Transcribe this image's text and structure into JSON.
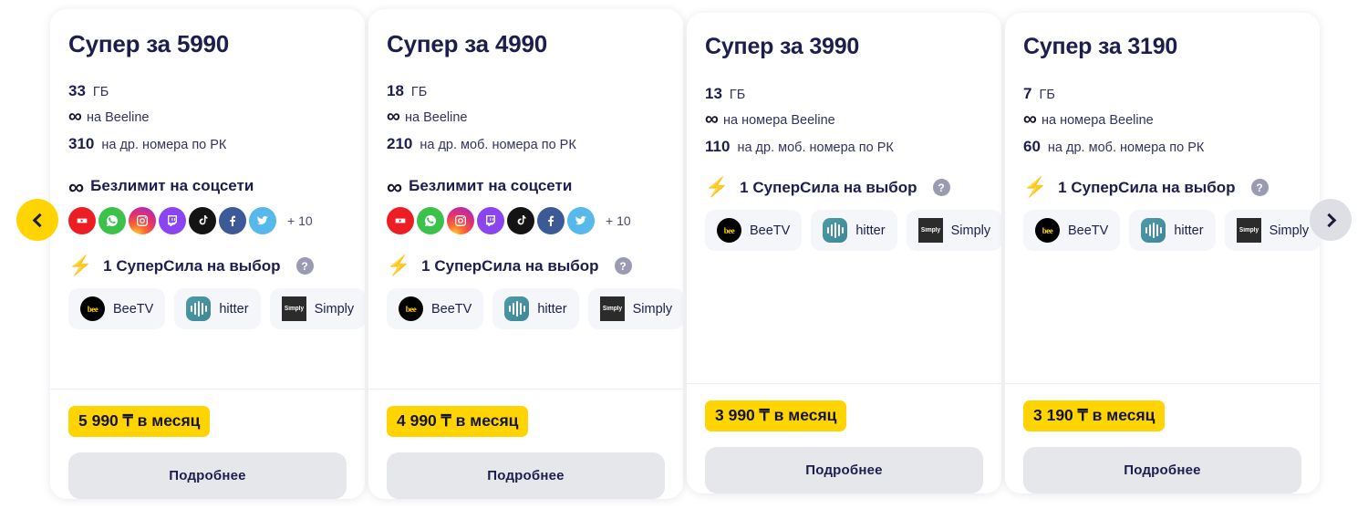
{
  "carousel": {
    "prev_label": "Предыдущий",
    "next_label": "Следующий",
    "prev_icon": "chevron-left-icon",
    "next_icon": "chevron-right-icon"
  },
  "social_more_label": "+ 10",
  "social_icons": [
    {
      "name": "youtube-icon",
      "label": "YouTube"
    },
    {
      "name": "whatsapp-icon",
      "label": "WhatsApp"
    },
    {
      "name": "instagram-icon",
      "label": "Instagram"
    },
    {
      "name": "twitch-icon",
      "label": "Twitch"
    },
    {
      "name": "tiktok-icon",
      "label": "TikTok"
    },
    {
      "name": "facebook-icon",
      "label": "Facebook"
    },
    {
      "name": "twitter-icon",
      "label": "Twitter"
    }
  ],
  "help_glyph": "?",
  "bolt_glyph": "⚡",
  "infinity_glyph": "∞",
  "colors": {
    "brand_yellow": "#FFD400",
    "title_navy": "#1D1D4E",
    "chip_bg": "#F5F6FA",
    "cta_bg": "#E6E7EB",
    "nav_next_bg": "#DEDFE5"
  },
  "cards": [
    {
      "title": "Супер за 5990",
      "limits": [
        {
          "value": "33",
          "label": "ГБ"
        },
        {
          "value": "∞",
          "label": "на Beeline",
          "is_infinity": true
        },
        {
          "value": "310",
          "label": "на др. номера по РК"
        }
      ],
      "social": {
        "heading": "Безлимит на соцсети",
        "more": "+ 10"
      },
      "supersila": {
        "heading": "1 СуперСила на выбор",
        "options": [
          {
            "name": "beetv",
            "label": "BeeTV"
          },
          {
            "name": "hitter",
            "label": "hitter"
          },
          {
            "name": "simply",
            "label": "Simply"
          }
        ]
      },
      "price": "5 990 ₸ в месяц",
      "cta": "Подробнее"
    },
    {
      "title": "Супер за 4990",
      "limits": [
        {
          "value": "18",
          "label": "ГБ"
        },
        {
          "value": "∞",
          "label": "на Beeline",
          "is_infinity": true
        },
        {
          "value": "210",
          "label": "на др. моб. номера по РК"
        }
      ],
      "social": {
        "heading": "Безлимит на соцсети",
        "more": "+ 10"
      },
      "supersila": {
        "heading": "1 СуперСила на выбор",
        "options": [
          {
            "name": "beetv",
            "label": "BeeTV"
          },
          {
            "name": "hitter",
            "label": "hitter"
          },
          {
            "name": "simply",
            "label": "Simply"
          }
        ]
      },
      "price": "4 990 ₸ в месяц",
      "cta": "Подробнее"
    },
    {
      "title": "Супер за 3990",
      "limits": [
        {
          "value": "13",
          "label": "ГБ"
        },
        {
          "value": "∞",
          "label": "на номера Beeline",
          "is_infinity": true
        },
        {
          "value": "110",
          "label": "на др. моб. номера по РК"
        }
      ],
      "social": null,
      "supersila": {
        "heading": "1 СуперСила на выбор",
        "options": [
          {
            "name": "beetv",
            "label": "BeeTV"
          },
          {
            "name": "hitter",
            "label": "hitter"
          },
          {
            "name": "simply",
            "label": "Simply"
          }
        ]
      },
      "price": "3 990 ₸ в месяц",
      "cta": "Подробнее"
    },
    {
      "title": "Супер за 3190",
      "limits": [
        {
          "value": "7",
          "label": "ГБ"
        },
        {
          "value": "∞",
          "label": "на номера Beeline",
          "is_infinity": true
        },
        {
          "value": "60",
          "label": "на др. моб. номера по РК"
        }
      ],
      "social": null,
      "supersila": {
        "heading": "1 СуперСила на выбор",
        "options": [
          {
            "name": "beetv",
            "label": "BeeTV"
          },
          {
            "name": "hitter",
            "label": "hitter"
          },
          {
            "name": "simply",
            "label": "Simply"
          }
        ]
      },
      "price": "3 190 ₸ в месяц",
      "cta": "Подробнее"
    }
  ]
}
